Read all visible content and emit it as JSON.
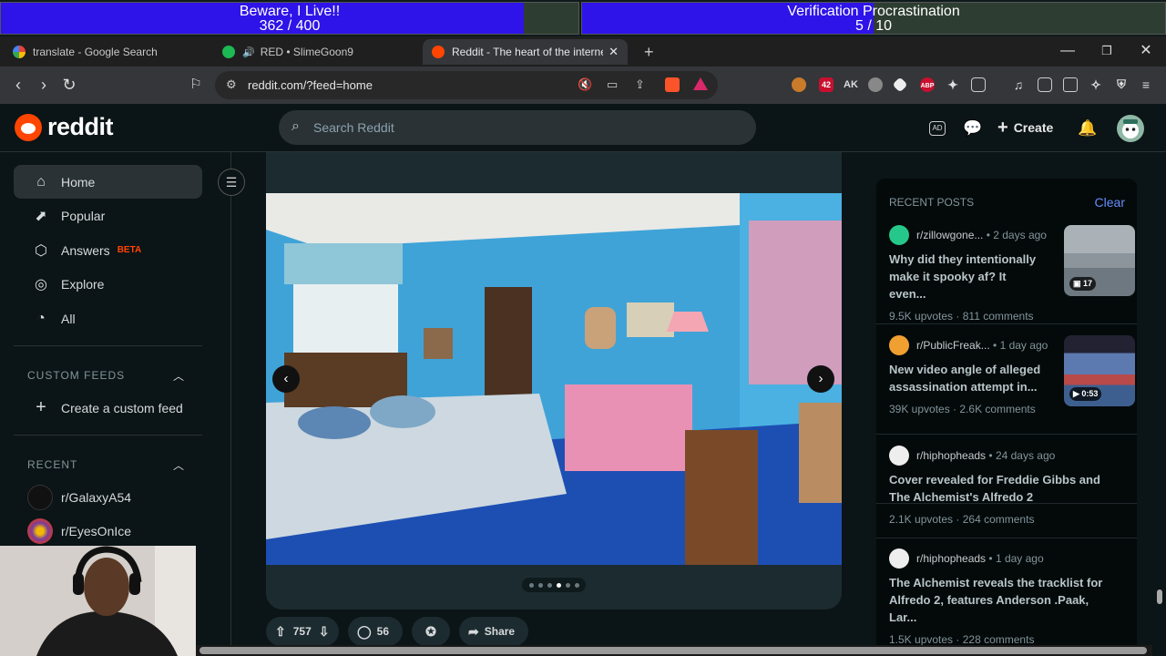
{
  "overlay": {
    "bar1": {
      "title": "Beware, I Live!!",
      "value_text": "362 / 400",
      "fraction": 0.905
    },
    "bar2": {
      "title": "Verification Procrastination",
      "value_text": "5 / 10",
      "fraction": 0.5
    }
  },
  "tabs": [
    {
      "title": "translate - Google Search",
      "icon": "google-icon"
    },
    {
      "title": "RED • SlimeGoon9",
      "icon": "spotify-icon"
    },
    {
      "title": "Reddit - The heart of the internet",
      "icon": "reddit-icon"
    }
  ],
  "toolbar": {
    "url": "reddit.com/?feed=home",
    "ext_badge_1": "42",
    "ext_badge_2": "3",
    "abp": "ABP"
  },
  "header": {
    "logo_text": "reddit",
    "search_placeholder": "Search Reddit",
    "create_label": "Create"
  },
  "nav": {
    "items": [
      {
        "label": "Home",
        "icon": "home-icon"
      },
      {
        "label": "Popular",
        "icon": "popular-icon"
      },
      {
        "label": "Answers",
        "icon": "answers-icon",
        "badge": "BETA"
      },
      {
        "label": "Explore",
        "icon": "explore-icon"
      },
      {
        "label": "All",
        "icon": "all-icon"
      }
    ],
    "custom_feeds_heading": "CUSTOM FEEDS",
    "create_feed_label": "Create a custom feed",
    "recent_heading": "RECENT",
    "recent": [
      "r/GalaxyA54",
      "r/EyesOnIce"
    ]
  },
  "post": {
    "carousel_active": 4,
    "carousel_count": 6,
    "upvotes": "757",
    "comments": "56",
    "share_label": "Share"
  },
  "rail": {
    "heading": "RECENT POSTS",
    "clear_label": "Clear",
    "posts": [
      {
        "sub": "r/zillowgone...",
        "age": "2 days ago",
        "title": "Why did they intentionally make it spooky af? It even...",
        "upvotes": "9.5K upvotes",
        "comments": "811 comments",
        "badge": "17"
      },
      {
        "sub": "r/PublicFreak...",
        "age": "1 day ago",
        "title": "New video angle of alleged assassination attempt in...",
        "upvotes": "39K upvotes",
        "comments": "2.6K comments",
        "badge": "0:53"
      },
      {
        "sub": "r/hiphopheads",
        "age": "24 days ago",
        "title": "Cover revealed for Freddie Gibbs and The Alchemist's Alfredo 2",
        "upvotes": "2.1K upvotes",
        "comments": "264 comments"
      },
      {
        "sub": "r/hiphopheads",
        "age": "1 day ago",
        "title": "The Alchemist reveals the tracklist for Alfredo 2, features Anderson .Paak, Lar...",
        "upvotes": "1.5K upvotes",
        "comments": "228 comments"
      }
    ]
  },
  "colors": {
    "bg": "#0b1416",
    "accent": "#ff4500",
    "link": "#648efc",
    "progress_fill": "#2e14e8"
  }
}
